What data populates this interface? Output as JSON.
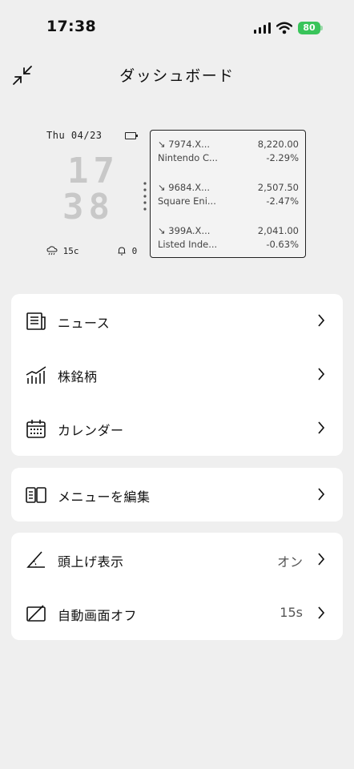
{
  "status_bar": {
    "time": "17:38",
    "battery": "80"
  },
  "header": {
    "title": "ダッシュボード"
  },
  "widget": {
    "date": "Thu 04/23",
    "hour": "17",
    "minute": "38",
    "weather": "15c",
    "alarm_count": "0",
    "stocks": [
      {
        "symbol": "↘ 7974.X...",
        "price": "8,220.00",
        "name": "Nintendo C...",
        "change": "-2.29%"
      },
      {
        "symbol": "↘ 9684.X...",
        "price": "2,507.50",
        "name": "Square Eni...",
        "change": "-2.47%"
      },
      {
        "symbol": "↘ 399A.X...",
        "price": "2,041.00",
        "name": "Listed Inde...",
        "change": "-0.63%"
      }
    ]
  },
  "menu": {
    "news": {
      "label": "ニュース",
      "icon": "newspaper-icon"
    },
    "stocks": {
      "label": "株銘柄",
      "icon": "stock-chart-icon"
    },
    "calendar": {
      "label": "カレンダー",
      "icon": "calendar-icon"
    },
    "edit_menu": {
      "label": "メニューを編集",
      "icon": "edit-menu-icon"
    },
    "head_up": {
      "label": "頭上げ表示",
      "value": "オン",
      "icon": "tilt-angle-icon"
    },
    "auto_off": {
      "label": "自動画面オフ",
      "value": "15s",
      "icon": "screen-off-icon"
    }
  }
}
